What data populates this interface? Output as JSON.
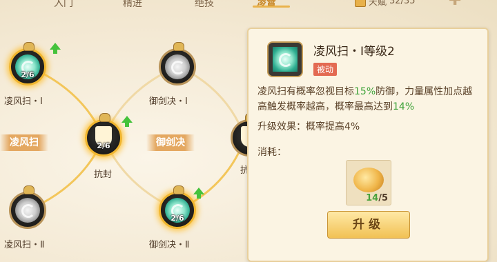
{
  "tabs": [
    {
      "label": "入门"
    },
    {
      "label": "精进"
    },
    {
      "label": "绝技"
    },
    {
      "label": "凌霄"
    }
  ],
  "talent": {
    "label": "天赋",
    "value": "32/35"
  },
  "tree": {
    "branches": [
      {
        "label": "凌风扫"
      },
      {
        "label": "御剑决"
      }
    ],
    "nodes": [
      {
        "name": "凌风扫・Ⅰ",
        "count": "2/6",
        "state": "active",
        "upgradable": true
      },
      {
        "name": "抗封",
        "count": "2/6",
        "state": "active",
        "upgradable": true
      },
      {
        "name": "凌风扫・Ⅱ",
        "count": "",
        "state": "locked",
        "upgradable": false
      },
      {
        "name": "御剑决・Ⅰ",
        "count": "",
        "state": "locked",
        "upgradable": false
      },
      {
        "name": "御剑决・Ⅱ",
        "count": "2/6",
        "state": "active",
        "upgradable": true
      },
      {
        "name": "抗",
        "count": "",
        "state": "locked",
        "upgradable": false
      }
    ]
  },
  "panel": {
    "title": "凌风扫・Ⅰ等级2",
    "badge": "被动",
    "desc_parts": {
      "p1": "凌风扫有概率忽视目标",
      "v1": "15%",
      "p2": "防御，力量属性加点越高触发概率越高，概率最高达到",
      "v2": "14%"
    },
    "upgrade_effect": "升级效果：概率提高4%",
    "consume_label": "消耗：",
    "item": {
      "have": "14",
      "need": "/5"
    },
    "upgrade_button": "升级"
  },
  "colors": {
    "accent": "#f1b62f",
    "highlight_green": "#3fa33a",
    "badge_red": "#e36a52"
  }
}
